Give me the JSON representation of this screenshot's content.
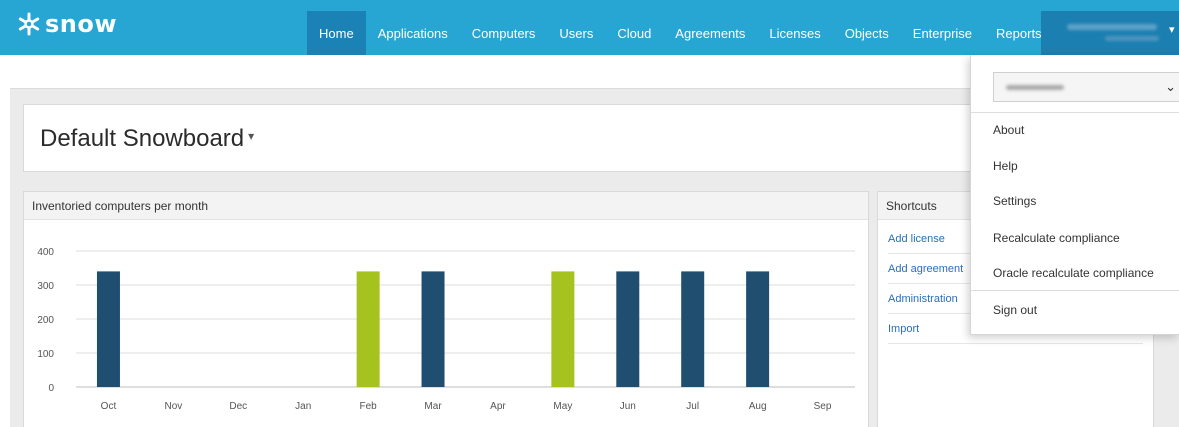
{
  "brand": {
    "logo_text": "snow",
    "icon": "snowflake-logo-icon"
  },
  "nav": {
    "items": [
      {
        "label": "Home",
        "active": true
      },
      {
        "label": "Applications"
      },
      {
        "label": "Computers"
      },
      {
        "label": "Users"
      },
      {
        "label": "Cloud"
      },
      {
        "label": "Agreements"
      },
      {
        "label": "Licenses"
      },
      {
        "label": "Objects"
      },
      {
        "label": "Enterprise"
      },
      {
        "label": "Reports"
      }
    ]
  },
  "user_menu": {
    "items": [
      {
        "label": "About"
      },
      {
        "label": "Help"
      },
      {
        "label": "Settings"
      },
      {
        "label": "Recalculate compliance"
      },
      {
        "label": "Oracle recalculate compliance"
      },
      {
        "label": "Sign out"
      }
    ]
  },
  "dashboard": {
    "title": "Default Snowboard"
  },
  "chart_panel": {
    "title": "Inventoried computers per month"
  },
  "shortcuts": {
    "title": "Shortcuts",
    "items": [
      {
        "label": "Add license"
      },
      {
        "label": "Add agreement"
      },
      {
        "label": "Administration"
      },
      {
        "label": "Import"
      }
    ]
  },
  "colors": {
    "nav_bg": "#27a6d3",
    "nav_active": "#1b82b5",
    "bar_primary": "#1f4e71",
    "bar_highlight": "#a6c21f",
    "link": "#2a6ebb"
  },
  "chart_data": {
    "type": "bar",
    "title": "Inventoried computers per month",
    "xlabel": "",
    "ylabel": "",
    "categories": [
      "Oct",
      "Nov",
      "Dec",
      "Jan",
      "Feb",
      "Mar",
      "Apr",
      "May",
      "Jun",
      "Jul",
      "Aug",
      "Sep"
    ],
    "values": [
      340,
      null,
      null,
      null,
      340,
      340,
      null,
      340,
      340,
      340,
      340,
      null
    ],
    "highlighted": [
      "Feb",
      "May"
    ],
    "ylim": [
      0,
      400
    ],
    "yticks": [
      "0",
      "100",
      "200",
      "300",
      "400"
    ],
    "grid": true,
    "legend": "none"
  }
}
